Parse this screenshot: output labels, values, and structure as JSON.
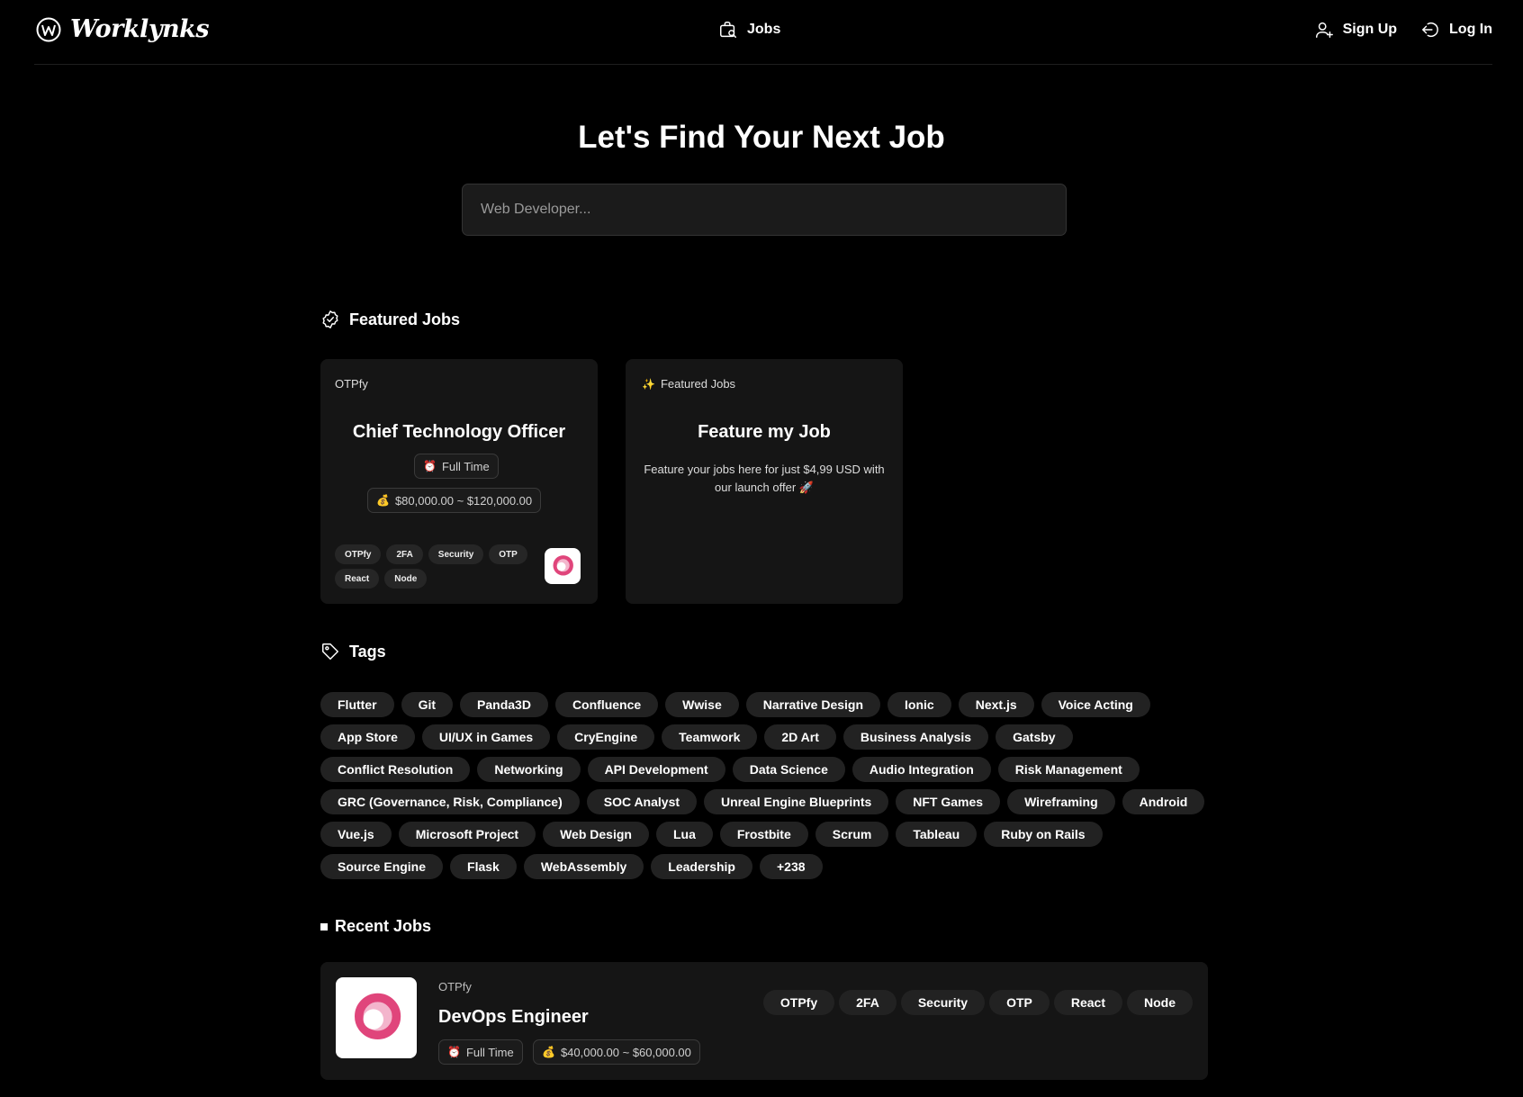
{
  "header": {
    "brand": "Worklynks",
    "jobs_label": "Jobs",
    "signup_label": "Sign Up",
    "login_label": "Log In"
  },
  "hero": {
    "title": "Let's Find Your Next Job",
    "search_placeholder": "Web Developer..."
  },
  "featured": {
    "section_title": "Featured Jobs",
    "job": {
      "company": "OTPfy",
      "title": "Chief Technology Officer",
      "type": "Full Time",
      "salary": "$80,000.00 ~ $120,000.00",
      "tags": [
        "OTPfy",
        "2FA",
        "Security",
        "OTP",
        "React",
        "Node"
      ]
    },
    "promo": {
      "header": "Featured Jobs",
      "title": "Feature my Job",
      "description": "Feature your jobs here for just $4,99 USD with our launch offer 🚀"
    }
  },
  "tags_section": {
    "title": "Tags",
    "tags": [
      "Flutter",
      "Git",
      "Panda3D",
      "Confluence",
      "Wwise",
      "Narrative Design",
      "Ionic",
      "Next.js",
      "Voice Acting",
      "App Store",
      "UI/UX in Games",
      "CryEngine",
      "Teamwork",
      "2D Art",
      "Business Analysis",
      "Gatsby",
      "Conflict Resolution",
      "Networking",
      "API Development",
      "Data Science",
      "Audio Integration",
      "Risk Management",
      "GRC (Governance, Risk, Compliance)",
      "SOC Analyst",
      "Unreal Engine Blueprints",
      "NFT Games",
      "Wireframing",
      "Android",
      "Vue.js",
      "Microsoft Project",
      "Web Design",
      "Lua",
      "Frostbite",
      "Scrum",
      "Tableau",
      "Ruby on Rails",
      "Source Engine",
      "Flask",
      "WebAssembly",
      "Leadership",
      "+238"
    ]
  },
  "recent": {
    "section_title": "Recent Jobs",
    "job": {
      "company": "OTPfy",
      "title": "DevOps Engineer",
      "type": "Full Time",
      "salary": "$40,000.00 ~ $60,000.00",
      "tags": [
        "OTPfy",
        "2FA",
        "Security",
        "OTP",
        "React",
        "Node"
      ]
    }
  },
  "colors": {
    "background": "#000000",
    "card": "#151515",
    "tag": "#222222",
    "logo_pink": "#e0457b"
  }
}
